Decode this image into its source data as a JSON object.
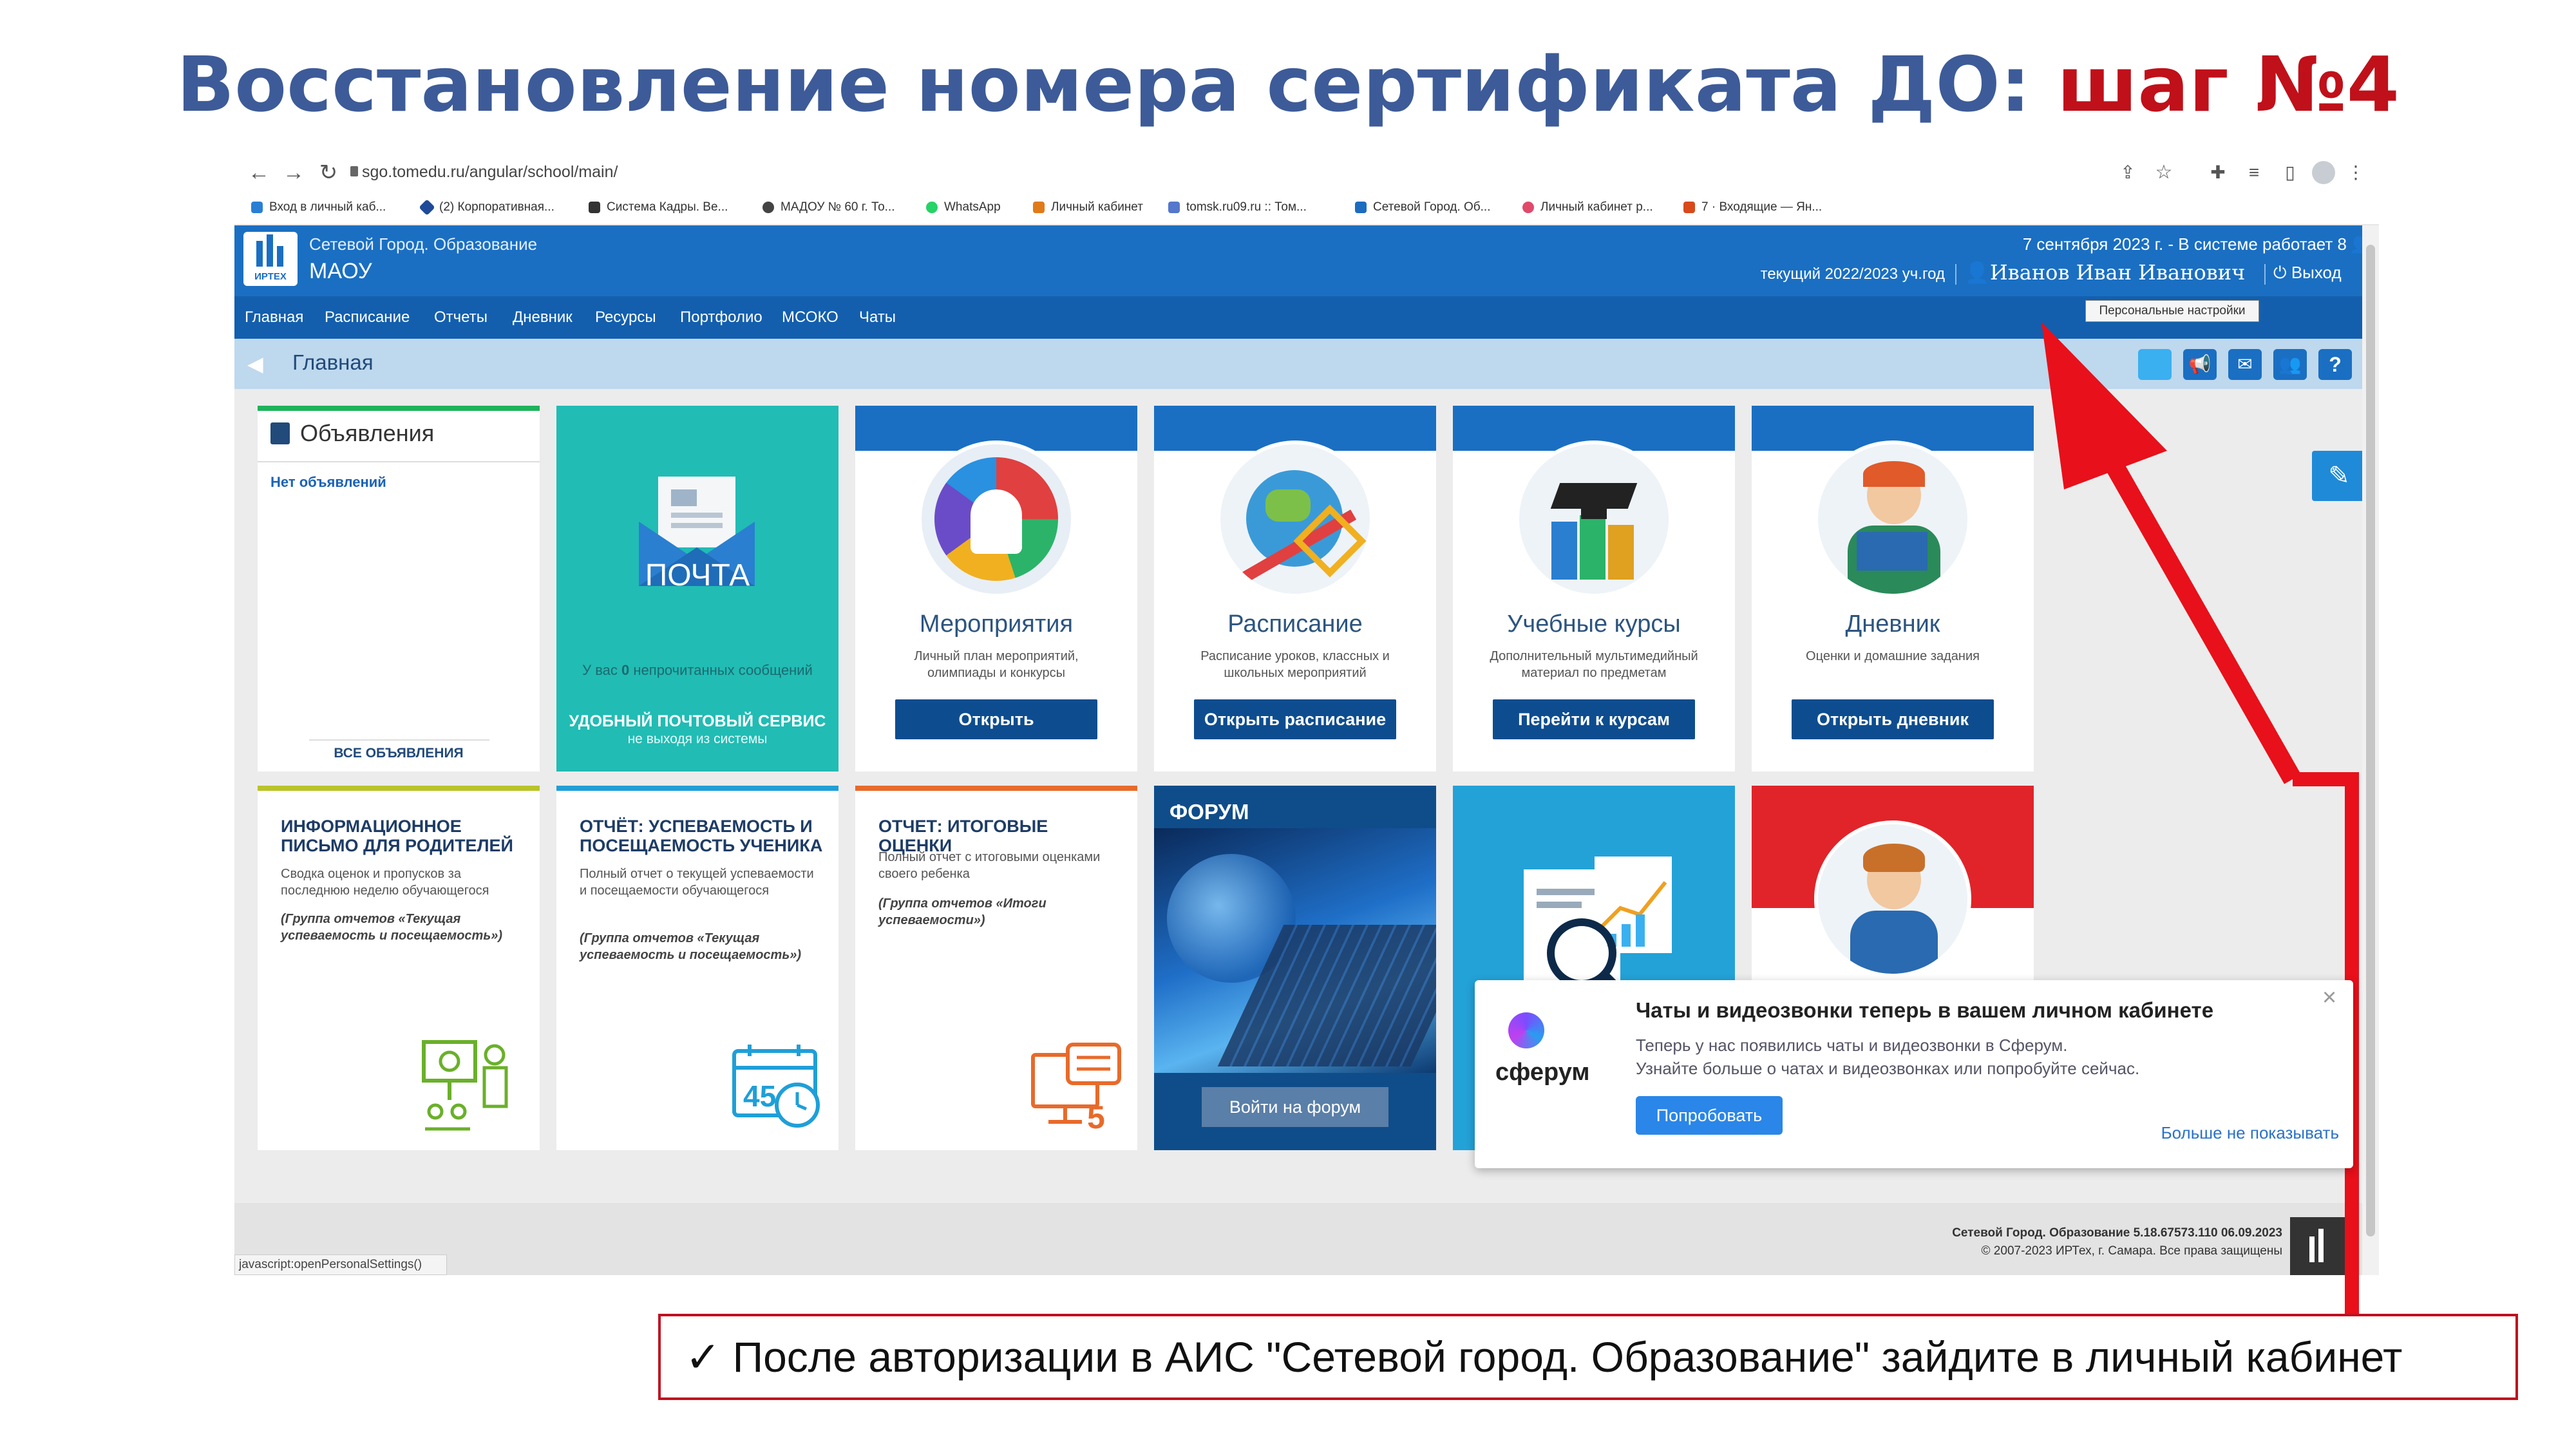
{
  "slide": {
    "title_main": "Восстановление номера сертификата ДО: ",
    "title_step": "шаг №4",
    "callout_check": "✓",
    "callout_text": "После авторизации в АИС \"Сетевой город. Образование\" зайдите в личный кабинет"
  },
  "browser": {
    "url": "sgo.tomedu.ru/angular/school/main/",
    "bookmarks": [
      "Вход в личный каб...",
      "(2) Корпоративная...",
      "Система Кадры. Ве...",
      "МАДОУ № 60 г. То...",
      "WhatsApp",
      "Личный кабинет",
      "tomsk.ru09.ru :: Том...",
      "Сетевой Город. Об...",
      "Личный кабинет р...",
      "7 · Входящие — Ян..."
    ],
    "status_url": "javascript:openPersonalSettings()"
  },
  "app": {
    "brand_line1": "Сетевой Город. Образование",
    "brand_line2": "МАОУ",
    "logo_text": "ИРТЕХ",
    "date_line": "7 сентября 2023 г. - В системе работает 8",
    "year_line": "текущий 2022/2023 уч.год",
    "user_name": "Иванов Иван Иванович",
    "logout_label": "Выход",
    "tooltip": "Персональные настройки",
    "menu": [
      "Главная",
      "Расписание",
      "Отчеты",
      "Дневник",
      "Ресурсы",
      "Портфолио",
      "МСОКО",
      "Чаты"
    ],
    "breadcrumb": "Главная"
  },
  "tiles": {
    "announcements": {
      "title": "Объявления",
      "empty": "Нет объявлений",
      "all_link": "ВСЕ ОБЪЯВЛЕНИЯ"
    },
    "mail": {
      "label": "ПОЧТА",
      "unread_prefix": "У вас",
      "unread_count": "0",
      "unread_suffix": "непрочитанных сообщений",
      "service": "УДОБНЫЙ ПОЧТОВЫЙ СЕРВИС",
      "service_sub": "не выходя из системы"
    },
    "events": {
      "title": "Мероприятия",
      "desc": "Личный план мероприятий, олимпиады и конкурсы",
      "button": "Открыть"
    },
    "schedule": {
      "title": "Расписание",
      "desc": "Расписание уроков, классных и школьных мероприятий",
      "button": "Открыть расписание"
    },
    "courses": {
      "title": "Учебные курсы",
      "desc": "Дополнительный мультимедийный материал по предметам",
      "button": "Перейти к курсам"
    },
    "diary": {
      "title": "Дневник",
      "desc": "Оценки и домашние задания",
      "button": "Открыть дневник"
    },
    "info_letter": {
      "title": "ИНФОРМАЦИОННОЕ ПИСЬМО ДЛЯ РОДИТЕЛЕЙ",
      "desc": "Сводка оценок и пропусков за последнюю неделю обучающегося",
      "group": "(Группа отчетов «Текущая успеваемость и посещаемость»)"
    },
    "report_progress": {
      "title": "ОТЧЁТ: УСПЕВАЕМОСТЬ И ПОСЕЩАЕМОСТЬ УЧЕНИКА",
      "desc": "Полный отчет о текущей успеваемости и посещаемости обучающегося",
      "group": "(Группа отчетов «Текущая успеваемость и посещаемость»)"
    },
    "report_final": {
      "title": "ОТЧЕТ: ИТОГОВЫЕ ОЦЕНКИ",
      "desc": "Полный отчет с итоговыми оценками своего ребенка",
      "group": "(Группа отчетов «Итоги успеваемости»)"
    },
    "forum": {
      "title": "ФОРУМ",
      "button": "Войти на форум"
    }
  },
  "popup": {
    "title": "Чаты и видеозвонки теперь в вашем личном кабинете",
    "line1": "Теперь у нас появились чаты и видеозвонки в Сферум.",
    "line2": "Узнайте больше о чатах и видеозвонках или попробуйте сейчас.",
    "logo_text": "сферум",
    "try_button": "Попробовать",
    "dismiss": "Больше не показывать",
    "close": "×"
  },
  "footer": {
    "line1": "Сетевой Город. Образование  5.18.67573.110  06.09.2023",
    "line2": "© 2007-2023 ИРТех, г. Самара. Все права защищены"
  },
  "colors": {
    "title_blue": "#3d5b98",
    "title_red": "#c0101a",
    "header_blue": "#1a6fc2",
    "menu_blue": "#135fae",
    "teal": "#21bcb4",
    "arrow_red": "#e8101a"
  },
  "icons": [
    "back-icon",
    "forward-icon",
    "reload-icon",
    "lock-icon",
    "share-icon",
    "star-icon",
    "extension-icon",
    "user-icon",
    "power-icon",
    "help-icon",
    "magic-wand-icon",
    "close-icon"
  ]
}
